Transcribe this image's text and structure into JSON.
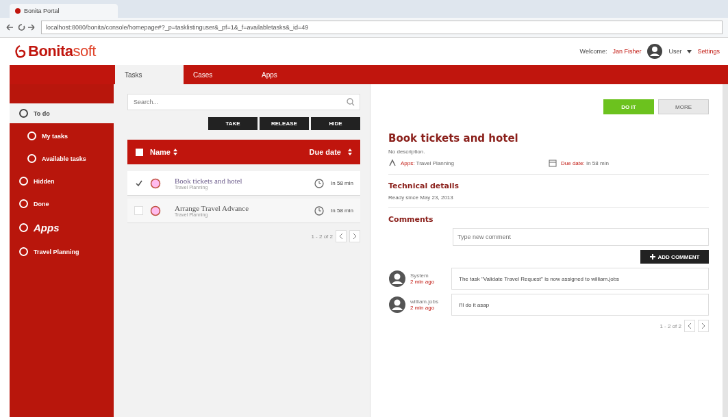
{
  "browser": {
    "tab_title": "Bonita Portal",
    "url": "localhost:8080/bonita/console/homepage#?_p=tasklistinguser&_pf=1&_f=availabletasks&_id=49"
  },
  "header": {
    "logo_main": "Bonita",
    "logo_accent": "soft",
    "welcome": "Welcome:",
    "user_name": "Jan Fisher",
    "user_menu": "User",
    "settings": "Settings"
  },
  "nav_tabs": [
    {
      "label": "Tasks",
      "selected": true
    },
    {
      "label": "Cases",
      "selected": false
    },
    {
      "label": "Apps",
      "selected": false
    }
  ],
  "sidebar": {
    "items": [
      {
        "label": "To do",
        "kind": "main",
        "selected": true,
        "children": [
          {
            "label": "My tasks",
            "selected": false
          },
          {
            "label": "Available tasks",
            "selected": false
          }
        ]
      },
      {
        "label": "Hidden",
        "kind": "main",
        "selected": false
      },
      {
        "label": "Done",
        "kind": "main",
        "selected": false
      },
      {
        "label": "Apps",
        "kind": "section",
        "selected": false
      },
      {
        "label": "Travel Planning",
        "kind": "main",
        "selected": false
      }
    ]
  },
  "task_list": {
    "search_placeholder": "Search...",
    "select_all_checked": false,
    "actions": [
      "TAKE",
      "RELEASE",
      "HIDE"
    ],
    "columns": [
      "Name",
      "Due date"
    ],
    "rows": [
      {
        "name": "Book tickets and hotel",
        "app": "Travel Planning",
        "due": "In 58 min",
        "checked": true,
        "selected": true
      },
      {
        "name": "Arrange Travel Advance",
        "app": "Travel Planning",
        "due": "In 58 min",
        "checked": false,
        "selected": false
      }
    ],
    "pager": "1 - 2 of 2"
  },
  "detail": {
    "primary_button": "DO IT",
    "more_button": "MORE",
    "title": "Book tickets and hotel",
    "description": "No description.",
    "app_label": "Apps:",
    "app_value": "Travel Planning",
    "due_label": "Due date:",
    "due_value": "In 58 min",
    "technical_heading": "Technical details",
    "ready_since": "Ready since May 23, 2013",
    "comments_heading": "Comments",
    "comment_placeholder": "Type new comment",
    "add_comment": "ADD COMMENT",
    "comments": [
      {
        "author": "System",
        "time": "2 min ago",
        "text": "The task \"Validate Travel Request\" is now assigned to william.jobs"
      },
      {
        "author": "william.jobs",
        "time": "2 min ago",
        "text": "I'll do it asap"
      }
    ],
    "pager": "1 - 2 of 2"
  }
}
